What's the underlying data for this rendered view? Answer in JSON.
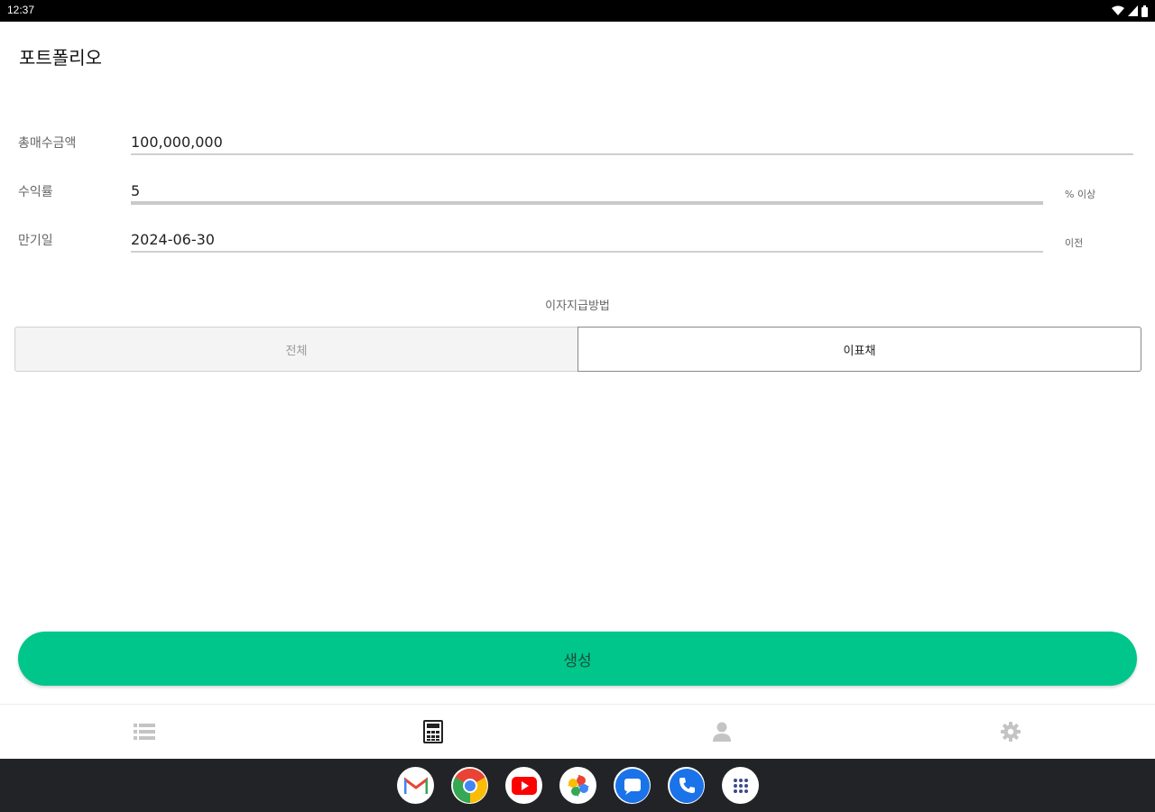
{
  "status_bar": {
    "time": "12:37",
    "icons": [
      "wifi-icon",
      "signal-icon",
      "battery-icon"
    ]
  },
  "app": {
    "title": "포트폴리오"
  },
  "form": {
    "total_amount": {
      "label": "총매수금액",
      "value": "100,000,000"
    },
    "yield": {
      "label": "수익률",
      "value": "5",
      "suffix": "% 이상"
    },
    "maturity": {
      "label": "만기일",
      "value": "2024-06-30",
      "suffix": "이전"
    }
  },
  "payment_method": {
    "title": "이자지급방법",
    "options": [
      {
        "label": "전체",
        "selected": false
      },
      {
        "label": "이표채",
        "selected": true
      }
    ]
  },
  "create_button": {
    "label": "생성",
    "color": "#00c68b"
  },
  "bottom_nav": {
    "items": [
      {
        "icon": "list-icon",
        "active": false
      },
      {
        "icon": "calculator-icon",
        "active": true
      },
      {
        "icon": "person-icon",
        "active": false
      },
      {
        "icon": "gear-icon",
        "active": false
      }
    ]
  },
  "dock": {
    "apps": [
      "gmail-icon",
      "chrome-icon",
      "youtube-icon",
      "photos-icon",
      "messages-icon",
      "phone-icon",
      "app-drawer-icon"
    ]
  }
}
